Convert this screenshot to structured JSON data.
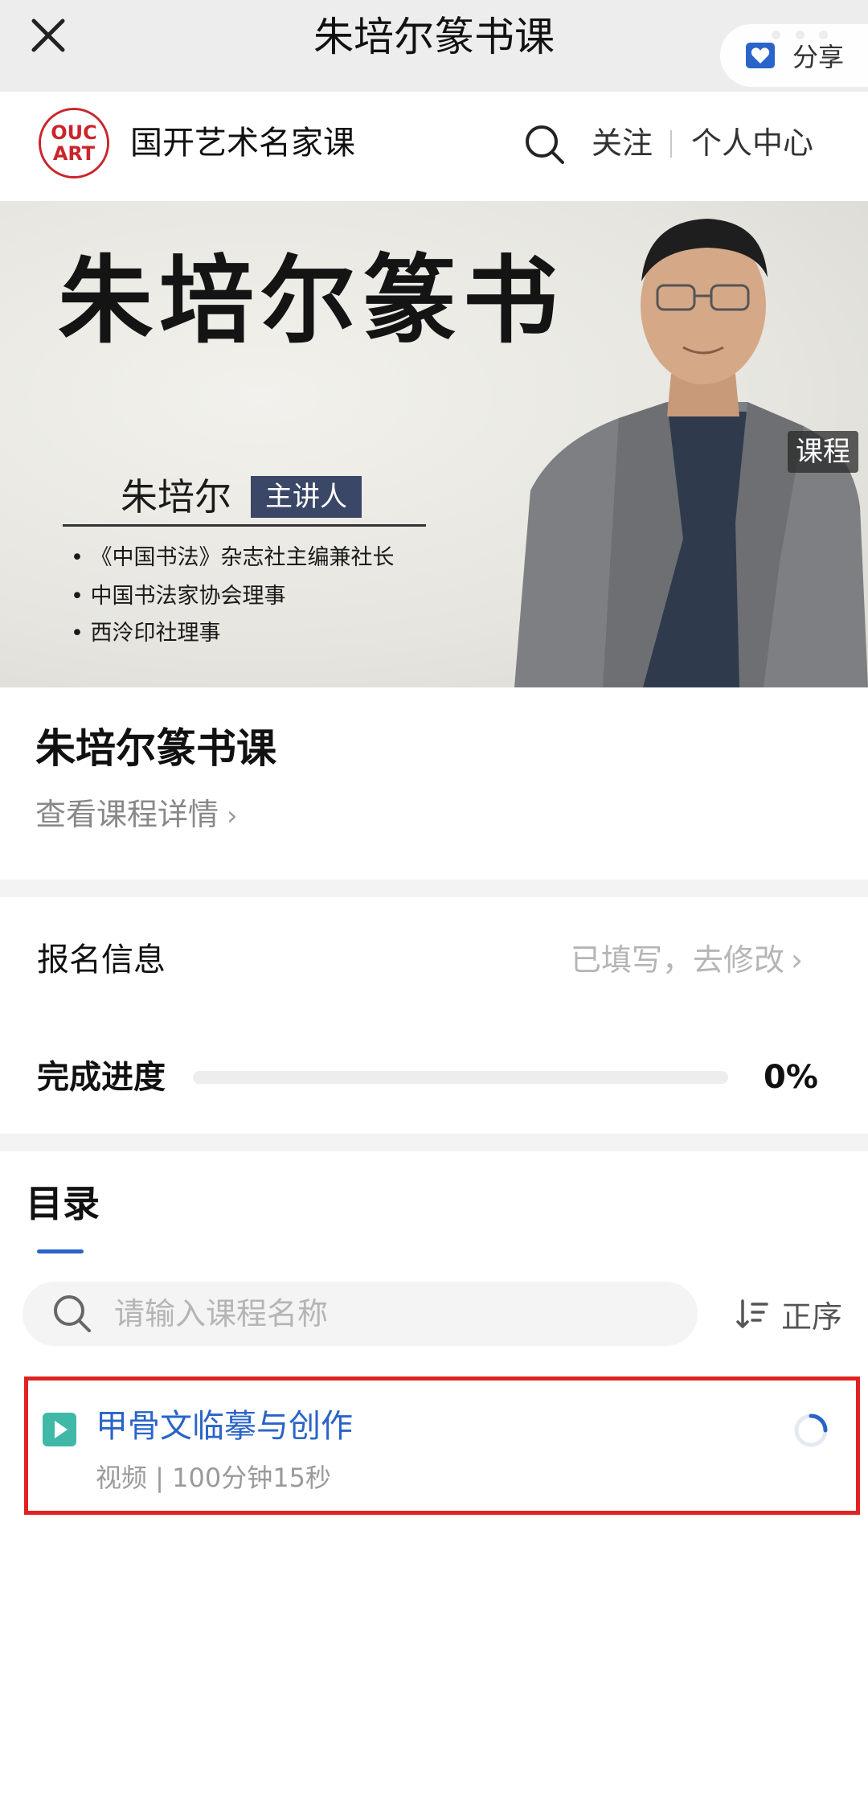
{
  "nav": {
    "title": "朱培尔篆书课",
    "close_icon": "close-icon",
    "more_icon": "more-dots-icon"
  },
  "brand": {
    "logo_text": "OUC ART",
    "name": "国开艺术名家课",
    "follow": "关注",
    "personal_center": "个人中心"
  },
  "banner": {
    "title": "朱培尔篆书",
    "lecturer": "朱培尔",
    "role": "主讲人",
    "credentials": [
      "• 《中国书法》杂志社主编兼社长",
      "• 中国书法家协会理事",
      "• 西泠印社理事"
    ],
    "share": "分享",
    "tag": "课程"
  },
  "course": {
    "title": "朱培尔篆书课",
    "detail_link": "查看课程详情"
  },
  "registration": {
    "label": "报名信息",
    "action": "已填写，去修改"
  },
  "progress": {
    "label": "完成进度",
    "value_text": "0%",
    "fraction": 0
  },
  "catalog": {
    "tab": "目录",
    "search_placeholder": "请输入课程名称",
    "sort_label": "正序",
    "items": [
      {
        "title": "甲骨文临摹与创作",
        "meta": "视频 | 100分钟15秒"
      }
    ]
  },
  "colors": {
    "accent": "#2a64c8",
    "highlight_border": "#e02222",
    "brand_red": "#c9262b",
    "play_icon": "#3fb8a8"
  }
}
